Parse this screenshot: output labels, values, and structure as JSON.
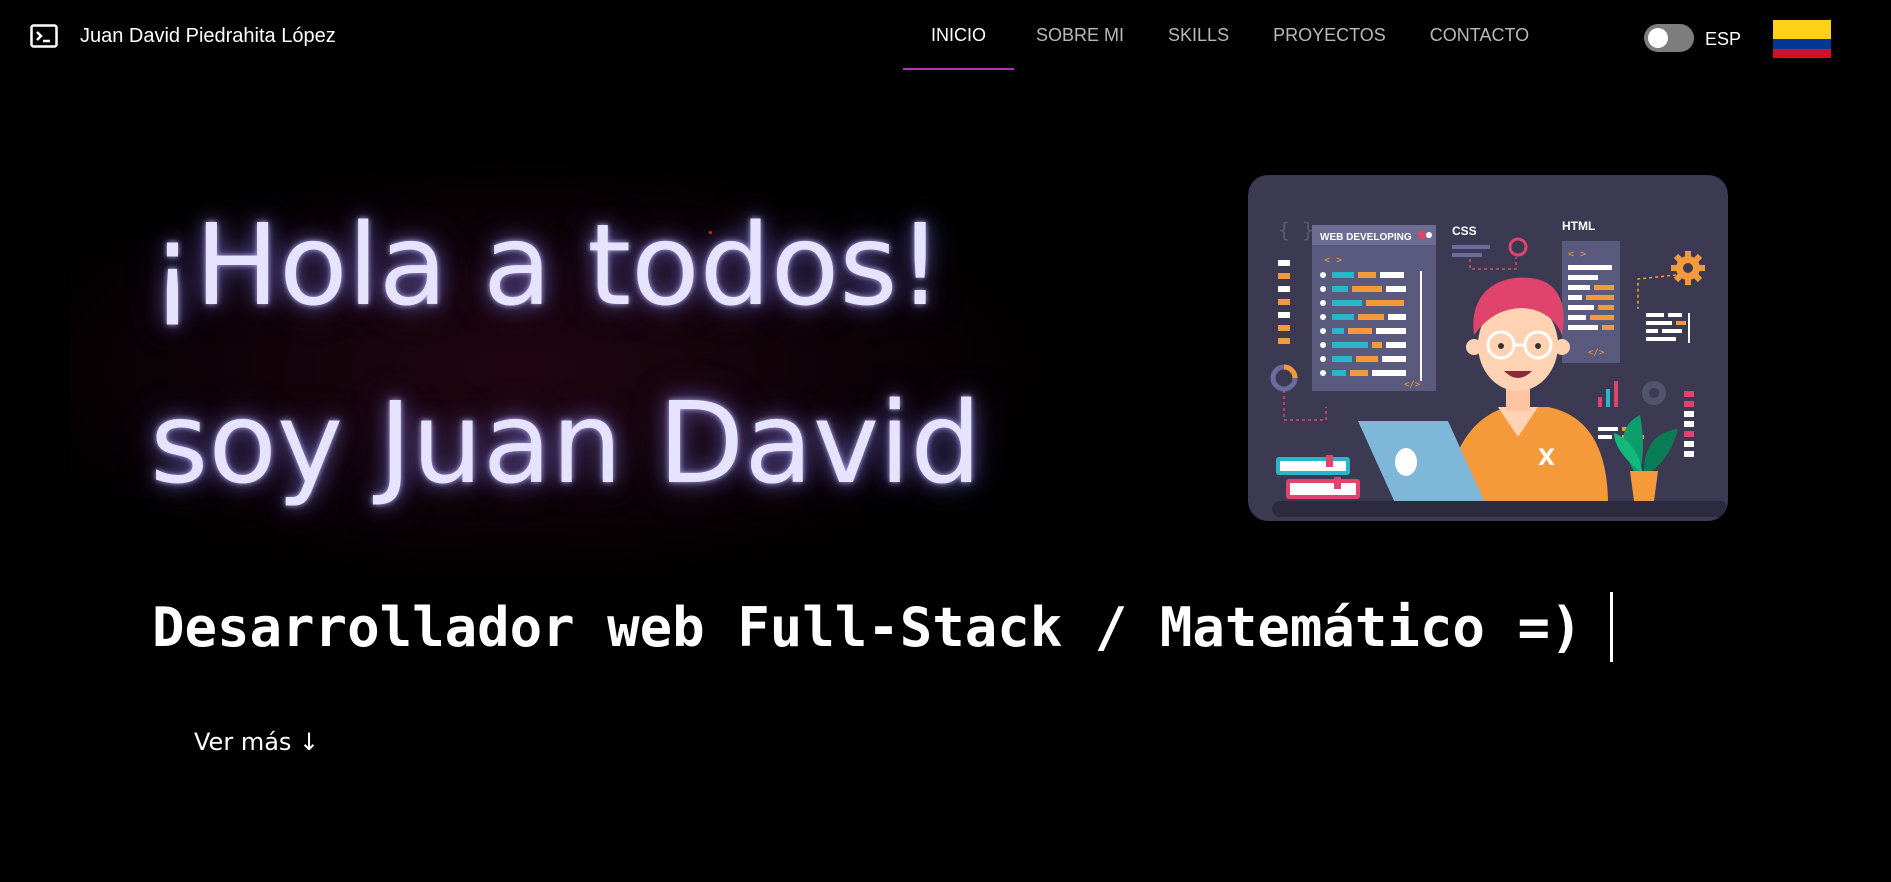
{
  "header": {
    "brand_icon": "terminal-icon",
    "brand_name": "Juan David Piedrahita López",
    "nav": [
      {
        "label": "INICIO",
        "active": true
      },
      {
        "label": "SOBRE MI",
        "active": false
      },
      {
        "label": "SKILLS",
        "active": false
      },
      {
        "label": "PROYECTOS",
        "active": false
      },
      {
        "label": "CONTACTO",
        "active": false
      }
    ],
    "theme_toggle_on": false,
    "language": "ESP",
    "flag_icon": "colombia-flag-icon"
  },
  "hero": {
    "greeting_line1": "¡Hola a todos!",
    "greeting_line2": "soy Juan David",
    "subtitle": "Desarrollador web Full-Stack / Matemático =)",
    "more_link": "Ver más ↓",
    "illustration": {
      "panel_title": "WEB DEVELOPING",
      "css_label": "CSS",
      "html_label": "HTML",
      "code_open": "< >",
      "code_close": "</>",
      "shirt_mark": "X"
    }
  },
  "colors": {
    "accent": "#b72fbd",
    "background": "#000000",
    "hero_text": "#e6e3ff",
    "illustration_bg": "#3b3a52"
  }
}
